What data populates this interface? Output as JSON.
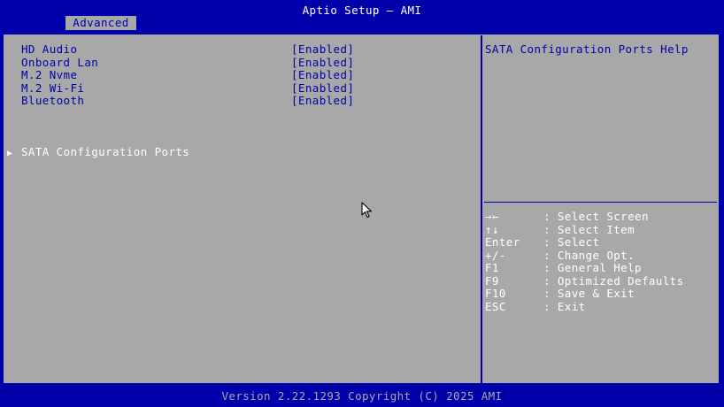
{
  "header": {
    "title": "Aptio Setup – AMI",
    "active_tab": "Advanced"
  },
  "settings": [
    {
      "label": "HD Audio",
      "value": "[Enabled]"
    },
    {
      "label": "Onboard Lan",
      "value": "[Enabled]"
    },
    {
      "label": "M.2 Nvme",
      "value": "[Enabled]"
    },
    {
      "label": "M.2 Wi-Fi",
      "value": "[Enabled]"
    },
    {
      "label": "Bluetooth",
      "value": "[Enabled]"
    }
  ],
  "submenu": {
    "label": "SATA Configuration Ports",
    "arrow": "▶"
  },
  "help": {
    "title": "SATA Configuration Ports Help"
  },
  "keys": [
    {
      "key": "→←",
      "desc": ": Select Screen"
    },
    {
      "key": "↑↓",
      "desc": ": Select Item"
    },
    {
      "key": "Enter",
      "desc": ": Select"
    },
    {
      "key": "+/-",
      "desc": ": Change Opt."
    },
    {
      "key": "F1",
      "desc": ": General Help"
    },
    {
      "key": "F9",
      "desc": ": Optimized Defaults"
    },
    {
      "key": "F10",
      "desc": ": Save & Exit"
    },
    {
      "key": "ESC",
      "desc": ": Exit"
    }
  ],
  "footer": {
    "version": "Version 2.22.1293 Copyright (C) 2025 AMI"
  },
  "colors": {
    "background": "#0000aa",
    "panel": "#a8a8a8",
    "highlight": "#ffffff"
  },
  "icons": {
    "pointer": "mouse-pointer-icon"
  }
}
